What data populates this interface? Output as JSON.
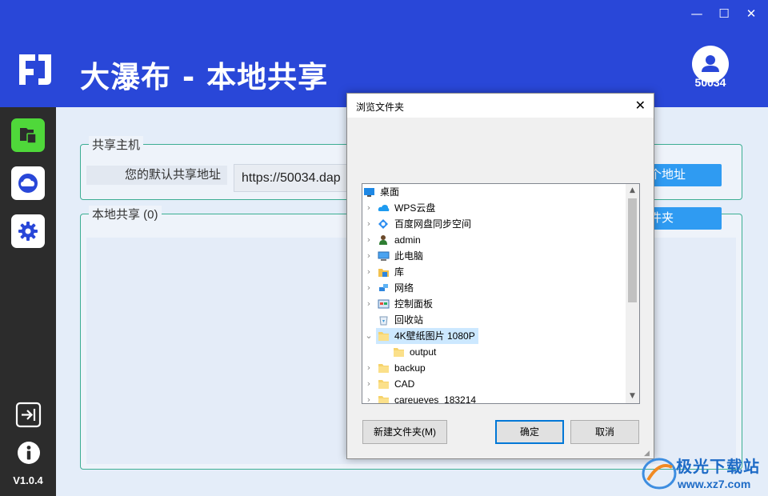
{
  "window": {
    "minimize_glyph": "—",
    "maximize_glyph": "☐",
    "close_glyph": "✕"
  },
  "header": {
    "title": "大瀑布 - 本地共享",
    "user_id": "50034",
    "brand_color": "#2947d8"
  },
  "sidebar": {
    "items": [
      {
        "name": "files-icon",
        "active": true
      },
      {
        "name": "cloud-icon",
        "active": false
      },
      {
        "name": "gear-icon",
        "active": false
      }
    ],
    "exit_icon": "exit-icon",
    "info_icon": "info-icon",
    "version": "V1.0.4"
  },
  "host_section": {
    "legend": "共享主机",
    "address_label": "您的默认共享地址",
    "address_value": "https://50034.dap",
    "button_label": "个地址"
  },
  "share_section": {
    "legend": "本地共享 (0)",
    "button_label": "件夹"
  },
  "dialog": {
    "title": "浏览文件夹",
    "close_glyph": "✕",
    "tree": [
      {
        "label": "桌面",
        "icon": "desktop-icon",
        "chevron": "",
        "level": 0,
        "selected": false
      },
      {
        "label": "WPS云盘",
        "icon": "wps-cloud-icon",
        "chevron": "›",
        "level": 1,
        "selected": false
      },
      {
        "label": "百度网盘同步空间",
        "icon": "baidu-netdisk-icon",
        "chevron": "›",
        "level": 1,
        "selected": false
      },
      {
        "label": "admin",
        "icon": "user-icon",
        "chevron": "›",
        "level": 1,
        "selected": false
      },
      {
        "label": "此电脑",
        "icon": "computer-icon",
        "chevron": "›",
        "level": 1,
        "selected": false
      },
      {
        "label": "库",
        "icon": "library-icon",
        "chevron": "›",
        "level": 1,
        "selected": false
      },
      {
        "label": "网络",
        "icon": "network-icon",
        "chevron": "›",
        "level": 1,
        "selected": false
      },
      {
        "label": "控制面板",
        "icon": "control-panel-icon",
        "chevron": "›",
        "level": 1,
        "selected": false
      },
      {
        "label": "回收站",
        "icon": "recycle-bin-icon",
        "chevron": "",
        "level": 1,
        "selected": false
      },
      {
        "label": "4K壁纸图片 1080P",
        "icon": "folder-icon",
        "chevron": "⌄",
        "level": 1,
        "selected": true
      },
      {
        "label": "output",
        "icon": "folder-icon",
        "chevron": "",
        "level": 2,
        "selected": false
      },
      {
        "label": "backup",
        "icon": "folder-icon",
        "chevron": "›",
        "level": 1,
        "selected": false
      },
      {
        "label": "CAD",
        "icon": "folder-icon",
        "chevron": "›",
        "level": 1,
        "selected": false
      },
      {
        "label": "careueyes_183214",
        "icon": "folder-icon",
        "chevron": "›",
        "level": 1,
        "selected": false
      }
    ],
    "scroll_up_glyph": "▲",
    "scroll_down_glyph": "▼",
    "new_folder_label": "新建文件夹(M)",
    "ok_label": "确定",
    "cancel_label": "取消"
  },
  "watermark": {
    "name": "极光下载站",
    "url": "www.xz7.com"
  }
}
